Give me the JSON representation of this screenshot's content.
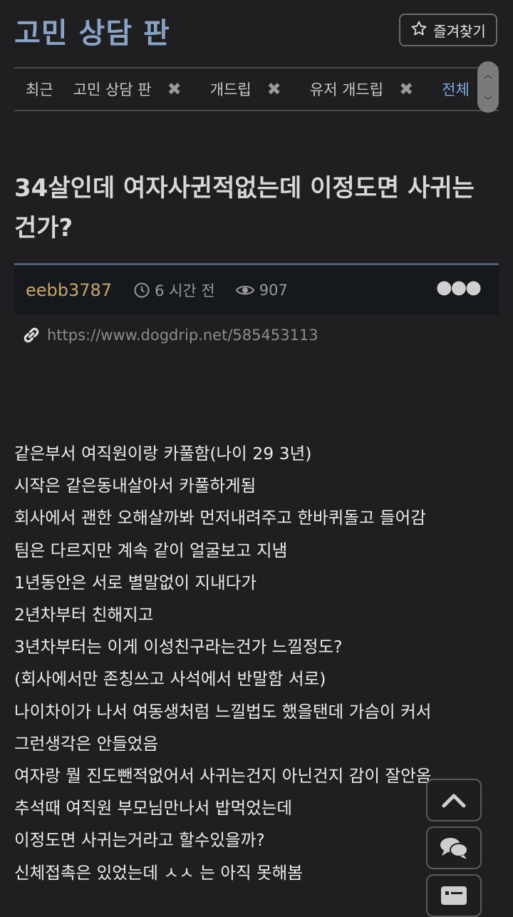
{
  "board": {
    "title": "고민 상담 판"
  },
  "favorite": {
    "label": "즐겨찾기",
    "icon": "star-icon"
  },
  "tabs": {
    "recent_label": "최근",
    "items": [
      {
        "label": "고민 상담 판"
      },
      {
        "label": "개드립"
      },
      {
        "label": "유저 개드립"
      }
    ],
    "all_label": "전체"
  },
  "post": {
    "title": "34살인데 여자사귄적없는데 이정도면 사귀는건가?",
    "author": "eebb3787",
    "time": "6 시간 전",
    "views": "907",
    "url": "https://www.dogdrip.net/585453113",
    "lines": [
      "같은부서 여직원이랑 카풀함(나이 29 3년)",
      "시작은 같은동내살아서 카풀하게됨",
      "회사에서 괜한 오해살까봐 먼저내려주고 한바퀴돌고 들어감",
      "팀은 다르지만 계속 같이 얼굴보고 지냄",
      "1년동안은 서로 별말없이 지내다가",
      "2년차부터 친해지고",
      "3년차부터는 이게 이성친구라는건가 느낄정도?",
      "(회사에서만 존칭쓰고 사석에서 반말함 서로)",
      "나이차이가 나서 여동생처럼 느낄법도 했을탠데 가슴이 커서",
      "그런생각은 안들었음",
      "여자랑 뭘 진도뺀적없어서 사귀는건지 아닌건지 감이 잘안옴",
      "추석때 여직원 부모님만나서 밥먹었는데",
      "이정도면 사귀는거라고 할수있을까?",
      "신체접촉은 있었는데 ㅅㅅ 는 아직 못해봄"
    ]
  },
  "colors": {
    "board_title": "#8aa3c8",
    "author": "#c9a766",
    "accent": "#7fa8e0"
  }
}
